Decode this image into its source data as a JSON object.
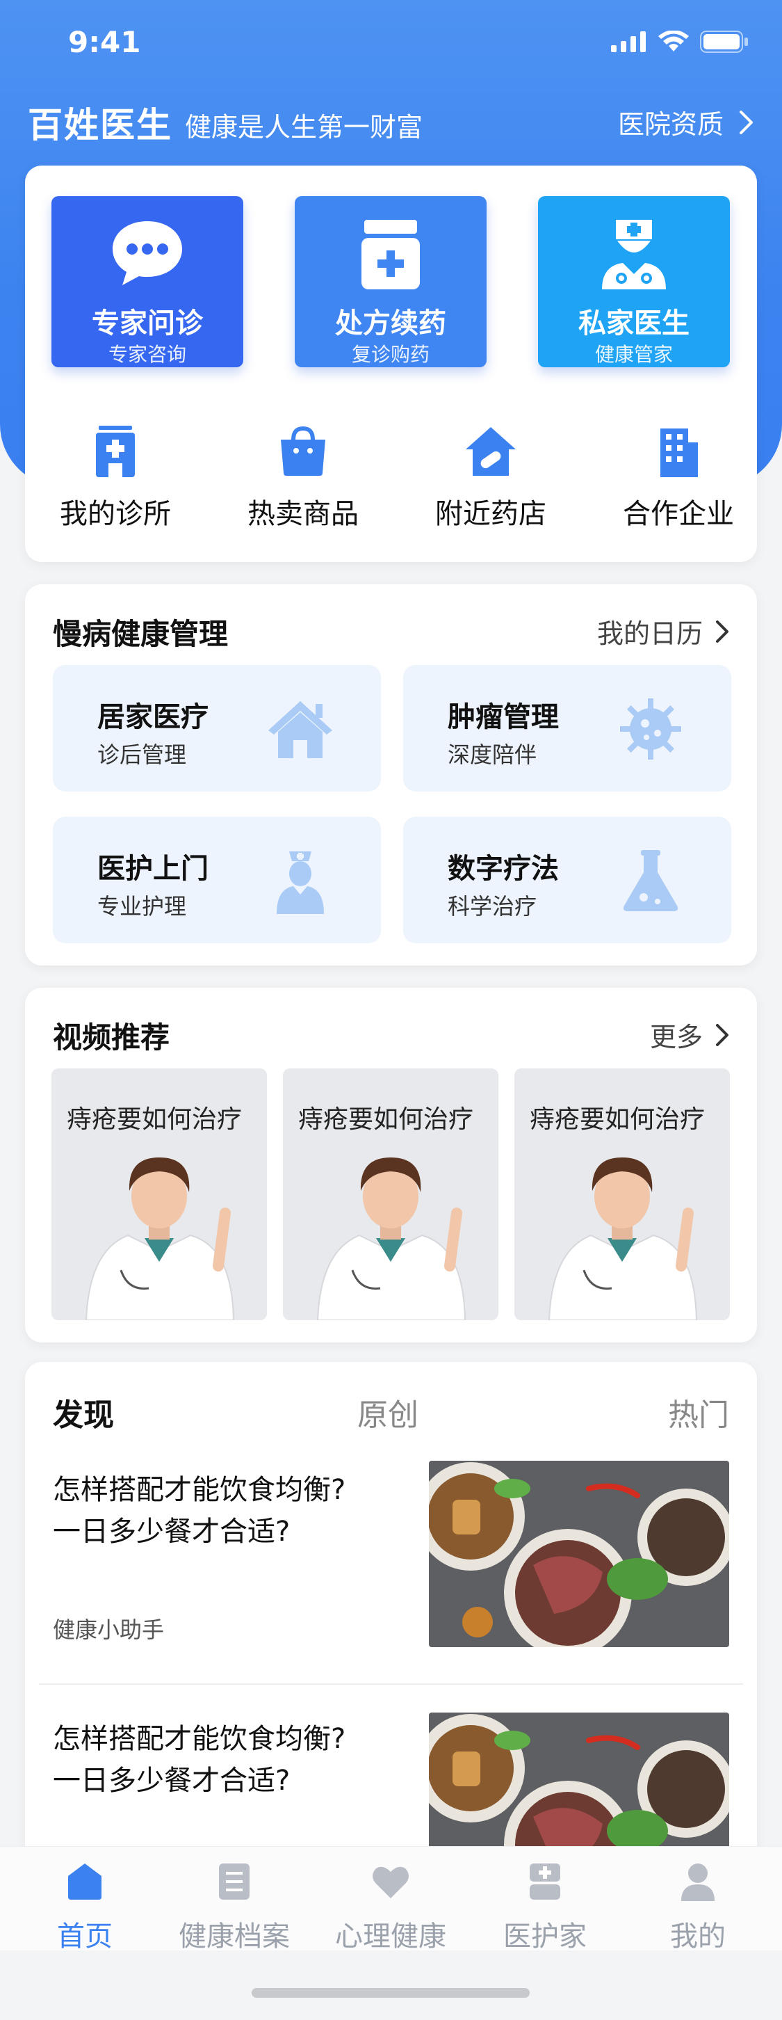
{
  "status_bar": {
    "time": "9:41"
  },
  "header": {
    "app_name": "百姓医生",
    "slogan": "健康是人生第一财富",
    "hospital_link": "医院资质"
  },
  "primary_services": [
    {
      "title": "专家问诊",
      "subtitle": "专家咨询",
      "icon": "chat-bubble-icon",
      "color": "#3567f0"
    },
    {
      "title": "处方续药",
      "subtitle": "复诊购药",
      "icon": "medicine-bottle-icon",
      "color": "#3f86f2"
    },
    {
      "title": "私家医生",
      "subtitle": "健康管家",
      "icon": "doctor-icon",
      "color": "#1ea3f5"
    }
  ],
  "secondary_services": [
    {
      "label": "我的诊所",
      "icon": "clinic-icon"
    },
    {
      "label": "热卖商品",
      "icon": "shopping-bag-icon"
    },
    {
      "label": "附近药店",
      "icon": "pharmacy-icon"
    },
    {
      "label": "合作企业",
      "icon": "building-icon"
    }
  ],
  "chronic": {
    "title": "慢病健康管理",
    "link": "我的日历",
    "items": [
      {
        "title": "居家医疗",
        "subtitle": "诊后管理",
        "icon": "house-icon"
      },
      {
        "title": "肿瘤管理",
        "subtitle": "深度陪伴",
        "icon": "virus-icon"
      },
      {
        "title": "医护上门",
        "subtitle": "专业护理",
        "icon": "nurse-icon"
      },
      {
        "title": "数字疗法",
        "subtitle": "科学治疗",
        "icon": "flask-icon"
      }
    ]
  },
  "videos": {
    "title": "视频推荐",
    "link": "更多",
    "items": [
      {
        "title": "痔疮要如何治疗"
      },
      {
        "title": "痔疮要如何治疗"
      },
      {
        "title": "痔疮要如何治疗"
      }
    ]
  },
  "discover": {
    "title": "发现",
    "tabs": [
      "原创",
      "热门"
    ],
    "articles": [
      {
        "title_line1": "怎样搭配才能饮食均衡?",
        "title_line2": "一日多少餐才合适?",
        "author": "健康小助手"
      },
      {
        "title_line1": "怎样搭配才能饮食均衡?",
        "title_line2": "一日多少餐才合适?",
        "author": ""
      }
    ]
  },
  "tabbar": {
    "items": [
      {
        "label": "首页",
        "icon": "home-icon",
        "active": true
      },
      {
        "label": "健康档案",
        "icon": "document-icon",
        "active": false
      },
      {
        "label": "心理健康",
        "icon": "heart-icon",
        "active": false
      },
      {
        "label": "医护家",
        "icon": "medical-kit-icon",
        "active": false
      },
      {
        "label": "我的",
        "icon": "user-icon",
        "active": false
      }
    ]
  }
}
